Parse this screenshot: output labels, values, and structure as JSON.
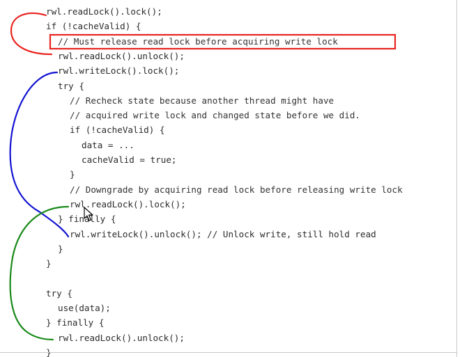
{
  "code": {
    "lines": [
      {
        "indent": 0,
        "text": "rwl.readLock().lock();"
      },
      {
        "indent": 0,
        "text": "if (!cacheValid) {"
      },
      {
        "indent": 1,
        "text": "// Must release read lock before acquiring write lock",
        "comment": true
      },
      {
        "indent": 1,
        "text": "rwl.readLock().unlock();"
      },
      {
        "indent": 1,
        "text": "rwl.writeLock().lock();"
      },
      {
        "indent": 1,
        "text": "try {"
      },
      {
        "indent": 2,
        "text": "// Recheck state because another thread might have",
        "comment": true
      },
      {
        "indent": 2,
        "text": "// acquired write lock and changed state before we did.",
        "comment": true
      },
      {
        "indent": 2,
        "text": "if (!cacheValid) {"
      },
      {
        "indent": 3,
        "text": "data = ..."
      },
      {
        "indent": 3,
        "text": "cacheValid = true;"
      },
      {
        "indent": 2,
        "text": "}"
      },
      {
        "indent": 2,
        "text": "// Downgrade by acquiring read lock before releasing write lock",
        "comment": true
      },
      {
        "indent": 2,
        "text": "rwl.readLock().lock();"
      },
      {
        "indent": 1,
        "text": "} finally {"
      },
      {
        "indent": 2,
        "text": "rwl.writeLock().unlock(); // Unlock write, still hold read"
      },
      {
        "indent": 1,
        "text": "}"
      },
      {
        "indent": 0,
        "text": "}"
      },
      {
        "indent": 0,
        "text": ""
      },
      {
        "indent": 0,
        "text": "try {"
      },
      {
        "indent": 1,
        "text": "use(data);"
      },
      {
        "indent": 0,
        "text": "} finally {"
      },
      {
        "indent": 1,
        "text": "rwl.readLock().unlock();"
      },
      {
        "indent": 0,
        "text": "}"
      }
    ]
  },
  "annotations": {
    "red_color": "#e8231f",
    "blue_color": "#1414d2",
    "green_color": "#1b8a1b"
  },
  "cursor": {
    "icon": "mouse-pointer-icon"
  }
}
